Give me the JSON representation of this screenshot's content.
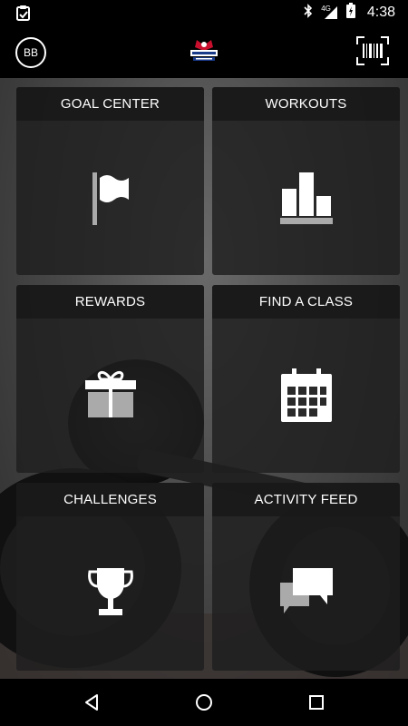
{
  "status_bar": {
    "time": "4:38",
    "network": "4G"
  },
  "header": {
    "avatar_initials": "BB"
  },
  "tiles": [
    {
      "label": "GOAL CENTER",
      "icon": "flag-icon"
    },
    {
      "label": "WORKOUTS",
      "icon": "podium-icon"
    },
    {
      "label": "REWARDS",
      "icon": "gift-icon"
    },
    {
      "label": "FIND A CLASS",
      "icon": "calendar-icon"
    },
    {
      "label": "CHALLENGES",
      "icon": "trophy-icon"
    },
    {
      "label": "ACTIVITY FEED",
      "icon": "chat-bubbles-icon"
    }
  ],
  "colors": {
    "tile_bg": "#1e1e1e",
    "header_bg": "#191919",
    "bar_bg": "#000000",
    "icon": "#ffffff"
  }
}
